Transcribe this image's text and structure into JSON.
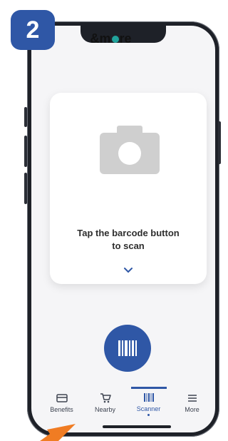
{
  "step_badge": "2",
  "header": {
    "logo_text_prefix": "&m",
    "logo_text_suffix": "re"
  },
  "card": {
    "line1": "Tap the barcode button",
    "line2": "to scan",
    "icons": [
      "camera-icon",
      "chevron-down-icon"
    ]
  },
  "scan_button": {
    "icon": "barcode-icon"
  },
  "tabs": [
    {
      "label": "Benefits",
      "icon": "card-icon"
    },
    {
      "label": "Nearby",
      "icon": "cart-icon"
    },
    {
      "label": "Scanner",
      "icon": "barcode-icon",
      "active": true
    },
    {
      "label": "More",
      "icon": "menu-icon"
    }
  ],
  "colors": {
    "accent": "#2f57a6",
    "logo_dot": "#21a39c",
    "phone_frame": "#1e2128",
    "arrow": "#f07c23"
  }
}
